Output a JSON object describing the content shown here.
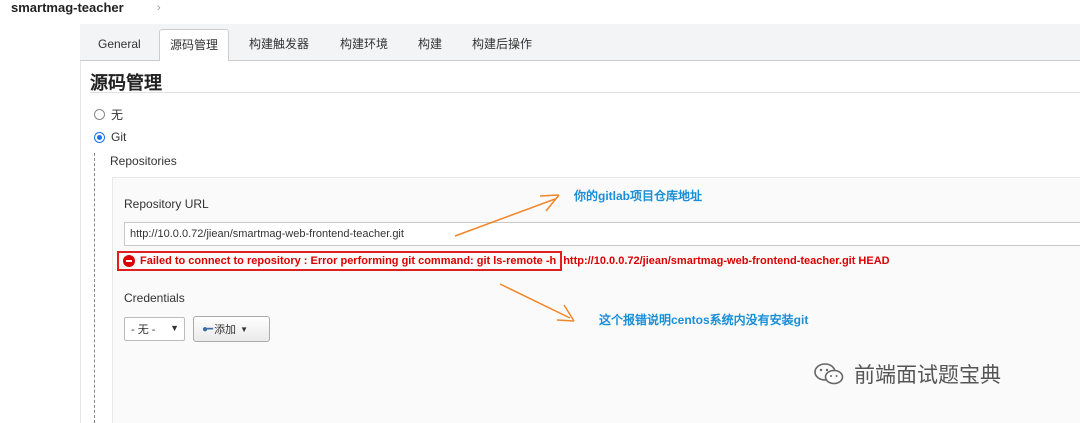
{
  "header": {
    "project_name": "smartmag-teacher",
    "chevron": "›"
  },
  "tabs": [
    {
      "label": "General"
    },
    {
      "label": "源码管理",
      "active": true
    },
    {
      "label": "构建触发器"
    },
    {
      "label": "构建环境"
    },
    {
      "label": "构建"
    },
    {
      "label": "构建后操作"
    }
  ],
  "scm": {
    "title": "源码管理",
    "options": [
      {
        "label": "无",
        "checked": false
      },
      {
        "label": "Git",
        "checked": true
      }
    ],
    "repositories_label": "Repositories",
    "repo_url_label": "Repository URL",
    "repo_url_value": "http://10.0.0.72/jiean/smartmag-web-frontend-teacher.git",
    "error_text": "Failed to connect to repository : Error performing git command: git ls-remote -h",
    "error_url": "http://10.0.0.72/jiean/smartmag-web-frontend-teacher.git HEAD",
    "credentials_label": "Credentials",
    "credentials_selected": "- 无 -",
    "add_button_label": "添加"
  },
  "annotations": {
    "gitlab_note": "你的gitlab项目仓库地址",
    "error_note": "这个报错说明centos系统内没有安装git",
    "color": "#1a8fd8",
    "arrow_color": "#f0862a"
  },
  "watermark": {
    "text": "前端面试题宝典",
    "icon": "wechat-icon"
  },
  "colors": {
    "error": "#dd0000",
    "accent": "#1a73e8"
  }
}
